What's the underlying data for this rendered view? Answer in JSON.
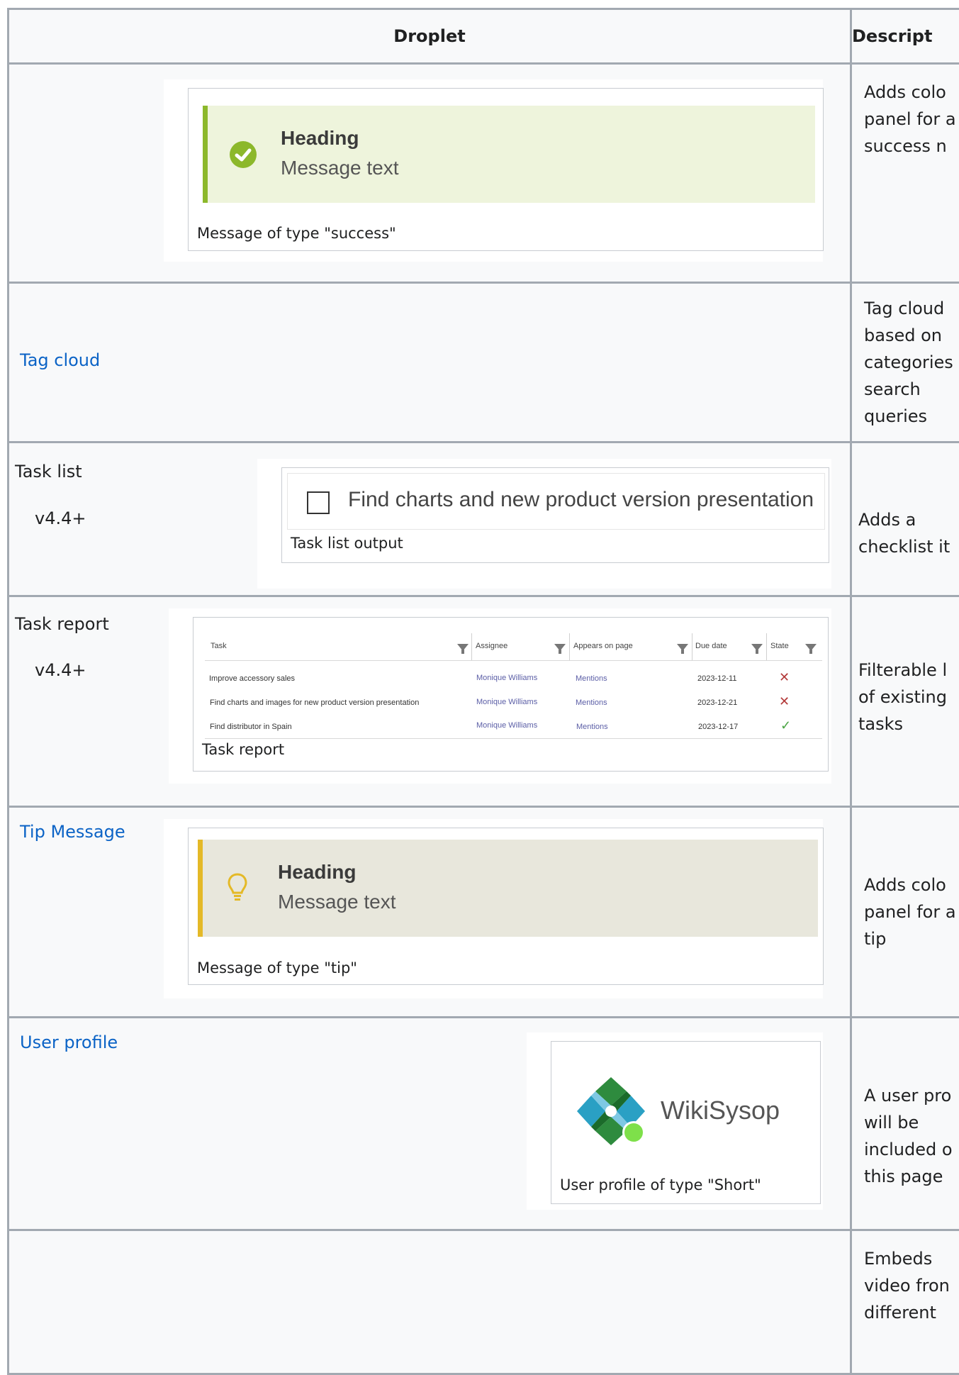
{
  "header": {
    "droplet": "Droplet",
    "description": "Descript"
  },
  "rows": {
    "success": {
      "heading": "Heading",
      "message": "Message text",
      "caption": "Message of type \"success\"",
      "desc": [
        "Adds colo",
        "panel for a",
        "success n"
      ]
    },
    "tagcloud": {
      "name": "Tag cloud",
      "desc": [
        "Tag cloud",
        "based on",
        "categories",
        "search",
        "queries"
      ]
    },
    "tasklist": {
      "name": "Task list",
      "version": "v4.4+",
      "item": "Find charts and new product version presentation",
      "caption": "Task list output",
      "desc": [
        "Adds a",
        "checklist it"
      ]
    },
    "taskreport": {
      "name": "Task report",
      "version": "v4.4+",
      "columns": [
        "Task",
        "Assignee",
        "Appears on page",
        "Due date",
        "State"
      ],
      "rows": [
        {
          "task": "Improve accessory sales",
          "assignee": "Monique Williams",
          "page": "Mentions",
          "due": "2023-12-11",
          "state": "✕"
        },
        {
          "task": "Find charts and images for new product version presentation",
          "assignee": "Monique Williams",
          "page": "Mentions",
          "due": "2023-12-21",
          "state": "✕"
        },
        {
          "task": "Find distributor in Spain",
          "assignee": "Monique Williams",
          "page": "Mentions",
          "due": "2023-12-17",
          "state": "✓"
        }
      ],
      "caption": "Task report",
      "desc": [
        "Filterable l",
        "of existing",
        "tasks"
      ]
    },
    "tip": {
      "name": "Tip Message",
      "heading": "Heading",
      "message": "Message text",
      "caption": "Message of type \"tip\"",
      "desc": [
        "Adds colo",
        "panel for a",
        "tip"
      ]
    },
    "userprofile": {
      "name": "User profile",
      "username": "WikiSysop",
      "caption": "User profile of type \"Short\"",
      "desc": [
        "A user pro",
        "will be",
        "included o",
        "this page"
      ]
    },
    "video": {
      "desc": [
        "Embeds",
        "video fron",
        "different"
      ]
    }
  },
  "colors": {
    "success_bar": "#8cb82b",
    "success_bg": "#eef4dc",
    "tip_bar": "#e4b927",
    "tip_bg": "#e8e7dc",
    "link": "#0b63c6",
    "border": "#a2a9b1"
  }
}
